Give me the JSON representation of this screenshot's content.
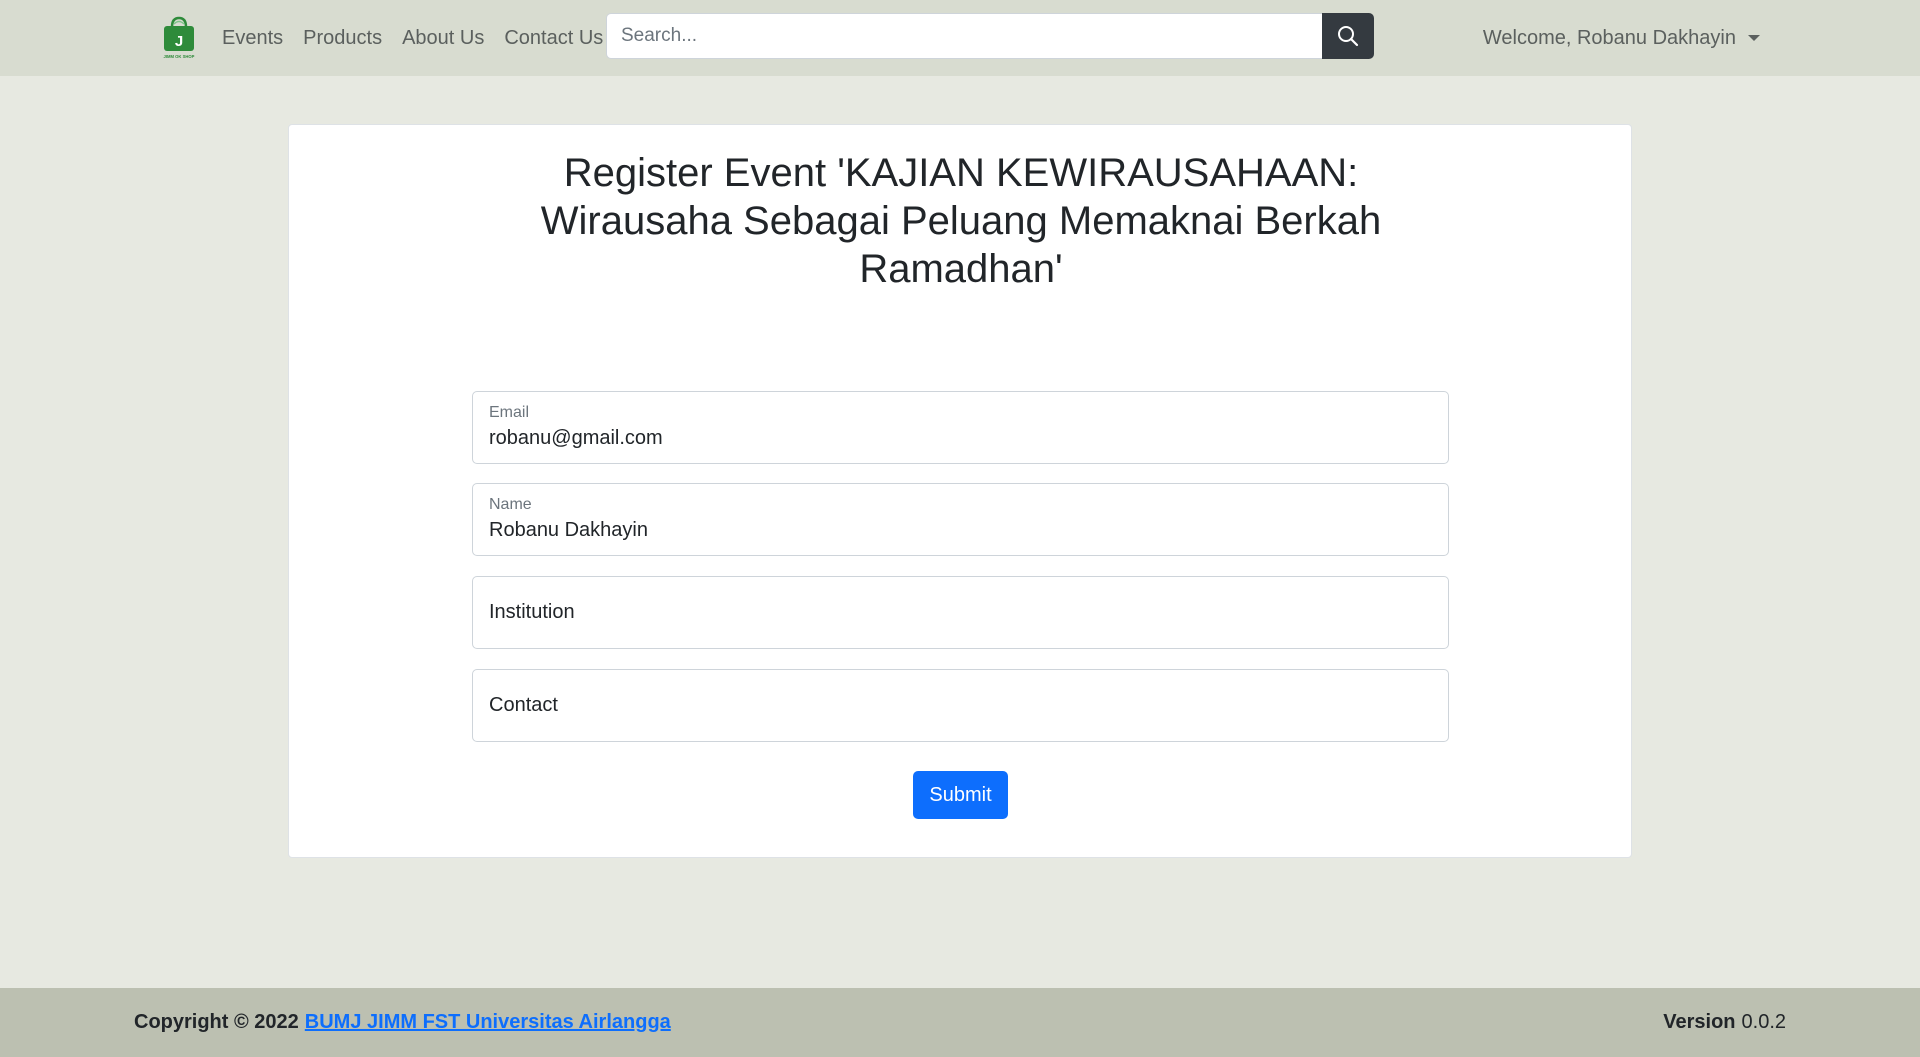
{
  "navbar": {
    "logo_icon": "shopping-bag-logo",
    "logo_letter": "J",
    "logo_text": "JIMM OK SHOP",
    "links": [
      {
        "label": "Events"
      },
      {
        "label": "Products"
      },
      {
        "label": "About Us"
      },
      {
        "label": "Contact Us"
      }
    ],
    "search": {
      "placeholder": "Search...",
      "value": "",
      "icon": "search-icon"
    },
    "user_menu": {
      "label": "Welcome, Robanu Dakhayin",
      "icon": "caret-down-icon"
    }
  },
  "form": {
    "title": "Register Event 'KAJIAN KEWIRAUSAHAAN: Wirausaha Sebagai Peluang Memaknai Berkah Ramadhan'",
    "fields": [
      {
        "label": "Email",
        "value": "robanu@gmail.com"
      },
      {
        "label": "Name",
        "value": "Robanu Dakhayin"
      },
      {
        "label": "Institution",
        "value": ""
      },
      {
        "label": "Contact",
        "value": ""
      }
    ],
    "submit_label": "Submit"
  },
  "footer": {
    "copyright_prefix": "Copyright © 2022",
    "copyright_link": "BUMJ JIMM FST Universitas Airlangga",
    "version_label": "Version",
    "version_value": "0.0.2"
  },
  "colors": {
    "navbar_bg": "#d8dcd0",
    "page_bg": "#e7e9e1",
    "footer_bg": "#bcc0b1",
    "primary": "#0d6efd",
    "search_button": "#343a40",
    "logo_green": "#2e8b3a"
  }
}
